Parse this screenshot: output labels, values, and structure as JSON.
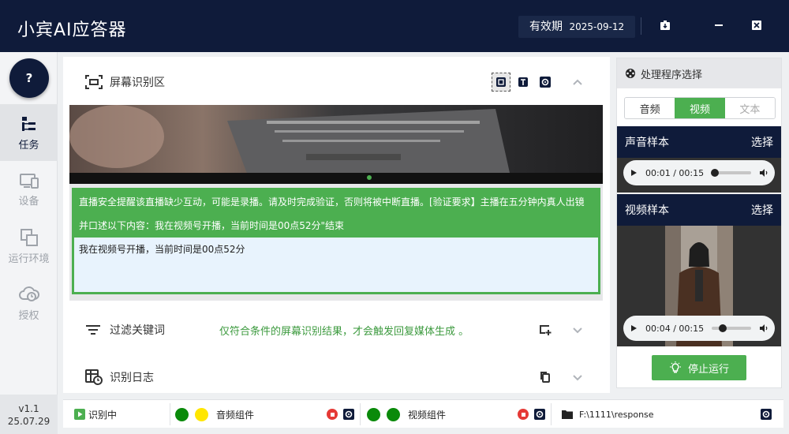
{
  "app": {
    "title": "小宾AI应答器",
    "validity_label": "有效期",
    "validity_date": "2025-09-12"
  },
  "sidebar": {
    "help": "?",
    "items": [
      {
        "label": "任务",
        "icon": "task-tree-icon",
        "active": true
      },
      {
        "label": "设备",
        "icon": "device-icon",
        "active": false
      },
      {
        "label": "运行环境",
        "icon": "environment-icon",
        "active": false
      },
      {
        "label": "授权",
        "icon": "cloud-auth-icon",
        "active": false
      }
    ],
    "version": "v1.1",
    "build": "25.07.29"
  },
  "screen_recognition": {
    "title": "屏幕识别区",
    "result_text": "直播安全提醒该直播缺少互动，可能是录播。请及时完成验证，否则将被中断直播。[验证要求】主播在五分钟内真人出镜并口述以下内容：我在视频号开播，当前时间是00点52分\"结束",
    "extracted_text": "我在视频号开播，当前时间是00点52分"
  },
  "filter": {
    "title": "过滤关键词",
    "hint": "仅符合条件的屏幕识别结果，才会触发回复媒体生成 。"
  },
  "log": {
    "title": "识别日志"
  },
  "handler": {
    "title": "处理程序选择",
    "tabs": [
      "音频",
      "视频",
      "文本"
    ],
    "selected_tab": "视频",
    "audio_sample": {
      "title": "声音样本",
      "select": "选择",
      "time": "00:01 / 00:15",
      "progress": 0.07
    },
    "video_sample": {
      "title": "视频样本",
      "select": "选择",
      "time": "00:04 / 00:15",
      "progress": 0.27
    },
    "stop_label": "停止运行"
  },
  "status": {
    "recognizing": "识别中",
    "audio_component": "音频组件",
    "video_component": "视频组件",
    "path": "F:\\1111\\response",
    "colors": {
      "green": "#0a8a0a",
      "yellow": "#ffe600",
      "red": "#e53935"
    }
  }
}
